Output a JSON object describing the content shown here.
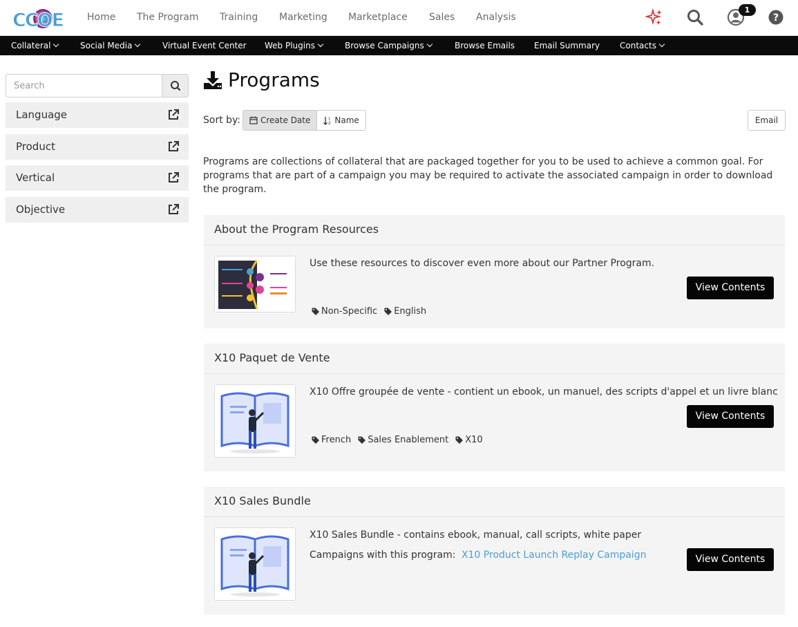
{
  "brand": {
    "logo_text": "CCOE",
    "accent": "#4b9fd5",
    "dark": "#0b0b0b"
  },
  "top_nav": {
    "items": [
      "Home",
      "The Program",
      "Training",
      "Marketing",
      "Marketplace",
      "Sales",
      "Analysis"
    ],
    "icons": [
      "sparkle-icon",
      "search-icon",
      "user-icon",
      "help-icon"
    ],
    "notification_count": "1"
  },
  "sub_nav": {
    "items": [
      {
        "label": "Collateral",
        "dropdown": true
      },
      {
        "label": "Social Media",
        "dropdown": true
      },
      {
        "label": "Virtual Event Center",
        "dropdown": false
      },
      {
        "label": "Web Plugins",
        "dropdown": true
      },
      {
        "label": "Browse Campaigns",
        "dropdown": true
      },
      {
        "label": "Browse Emails",
        "dropdown": false
      },
      {
        "label": "Email Summary",
        "dropdown": false
      },
      {
        "label": "Contacts",
        "dropdown": true
      }
    ]
  },
  "sidebar": {
    "search_placeholder": "Search",
    "filters": [
      "Language",
      "Product",
      "Vertical",
      "Objective"
    ]
  },
  "main": {
    "title": "Programs",
    "sort_label": "Sort by:",
    "sort_options": [
      "Create Date",
      "Name"
    ],
    "email_label": "Email",
    "intro": "Programs are collections of collateral that are packaged together for you to be used to achieve a common goal. For programs that are part of a campaign you may be required to activate the associated campaign in order to download the program."
  },
  "programs": [
    {
      "title": "About the Program Resources",
      "description": "Use these resources to discover even more about our Partner Program.",
      "tags": [
        "Non-Specific",
        "English"
      ],
      "button": "View Contents"
    },
    {
      "title": "X10 Paquet de Vente",
      "description": "X10 Offre groupée de vente - contient un ebook, un manuel, des scripts d'appel et un livre blanc",
      "tags": [
        "French",
        "Sales Enablement",
        "X10"
      ],
      "button": "View Contents"
    },
    {
      "title": "X10 Sales Bundle",
      "description": "X10 Sales Bundle - contains ebook, manual, call scripts, white paper",
      "campaign_label": "Campaigns with this program:",
      "campaign_link": "X10 Product Launch Replay Campaign",
      "button": "View Contents"
    }
  ]
}
